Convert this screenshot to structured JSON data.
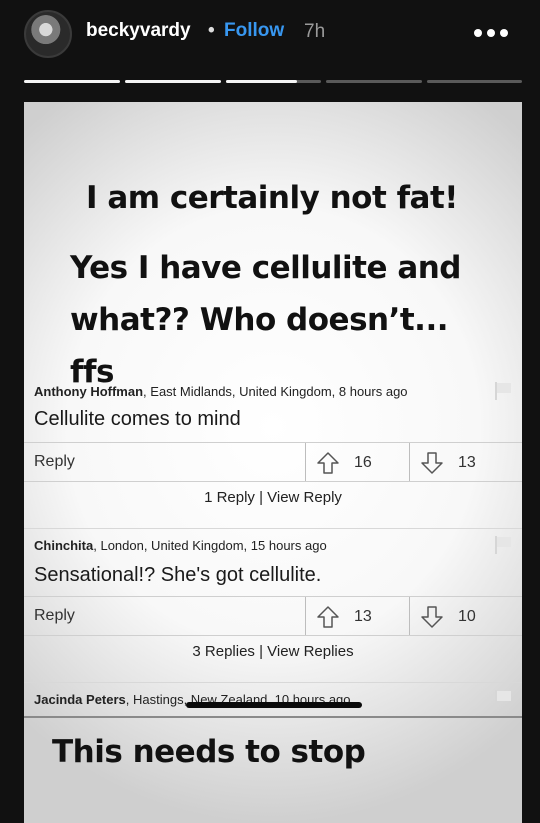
{
  "header": {
    "username": "beckyvardy",
    "separator": "•",
    "follow_label": "Follow",
    "time_ago": "7h"
  },
  "story_progress": {
    "segments": 5,
    "completed": 2,
    "current_fraction": 0.75
  },
  "card": {
    "headline_1": "I am certainly not fat!",
    "headline_2": "Yes I have cellulite and what?? Who doesn’t... ffs",
    "comments": [
      {
        "author": "Anthony Hoffman",
        "location": ", East Midlands, United Kingdom, 8 hours ago",
        "text": "Cellulite comes to mind",
        "reply_label": "Reply",
        "upvotes": "16",
        "downvotes": "13",
        "replies_link": "1 Reply | View Reply"
      },
      {
        "author": "Chinchita",
        "location": ", London, United Kingdom, 15 hours ago",
        "text": "Sensational!? She's got cellulite.",
        "reply_label": "Reply",
        "upvotes": "13",
        "downvotes": "10",
        "replies_link": "3 Replies | View Replies"
      },
      {
        "author": "Jacinda Peters",
        "location": ", Hastings, New Zealand, 10 hours ago"
      }
    ],
    "footer_text": "This needs to stop"
  },
  "colors": {
    "follow": "#3897f0",
    "background": "#111111",
    "card": "#f8f8f8"
  }
}
